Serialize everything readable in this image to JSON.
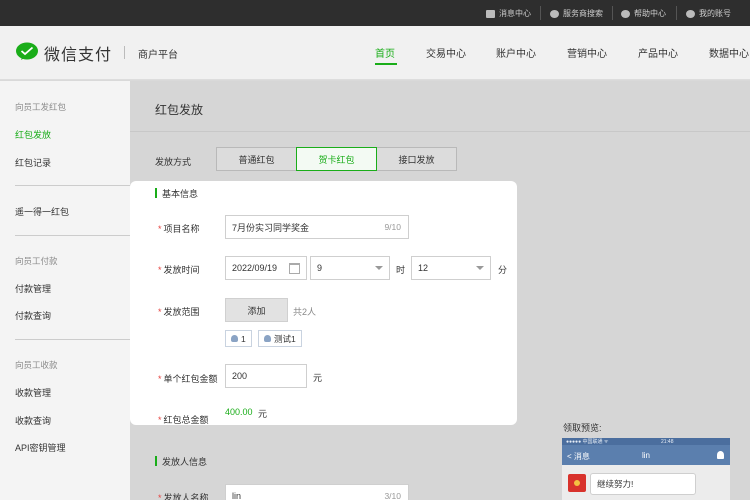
{
  "topbar": {
    "items": [
      {
        "label": "消息中心",
        "icon": "mail-icon"
      },
      {
        "label": "服务商搜索",
        "icon": "search-circle-icon"
      },
      {
        "label": "帮助中心",
        "icon": "help-icon"
      },
      {
        "label": "我的账号",
        "icon": "user-icon"
      }
    ]
  },
  "header": {
    "logo_text": "微信支付",
    "platform": "商户平台",
    "nav": [
      "首页",
      "交易中心",
      "账户中心",
      "营销中心",
      "产品中心",
      "数据中心"
    ],
    "brand_color": "#1aad19"
  },
  "sidebar": {
    "group1": "向员工发红包",
    "item_send": "红包发放",
    "item_records": "红包记录",
    "item_random": "遥一得一红包",
    "group2": "向员工付款",
    "item_pay_manage": "付款管理",
    "item_pay_query": "付款查询",
    "group3": "向员工收款",
    "item_collect_manage": "收款管理",
    "item_collect_query": "收款查询",
    "item_api": "API密钥管理"
  },
  "main": {
    "title": "红包发放",
    "method_label": "发放方式",
    "methods": [
      "普通红包",
      "贺卡红包",
      "接口发放"
    ],
    "basic_section": "基本信息",
    "project_label": "项目名称",
    "project_value": "7月份实习同学奖金",
    "project_count": "9/10",
    "time_label": "发放时间",
    "date_value": "2022/09/19",
    "hour_value": "9",
    "hour_unit": "时",
    "minute_value": "12",
    "minute_unit": "分",
    "scope_label": "发放范围",
    "add_button": "添加",
    "scope_count": "共2人",
    "tags": [
      "1",
      "测试1"
    ],
    "amount_label": "单个红包金额",
    "amount_value": "200",
    "amount_unit": "元",
    "total_label": "红包总金额",
    "total_value": "400.00",
    "total_unit": "元",
    "sender_section": "发放人信息",
    "sender_label": "发放人名称",
    "sender_value": "lin",
    "sender_count": "3/10"
  },
  "preview": {
    "label": "领取预览:",
    "status_left": "●●●●● 中国联通 ᯤ",
    "status_time": "21:48",
    "back": "< 消息",
    "title": "lin",
    "message": "继续努力!"
  }
}
